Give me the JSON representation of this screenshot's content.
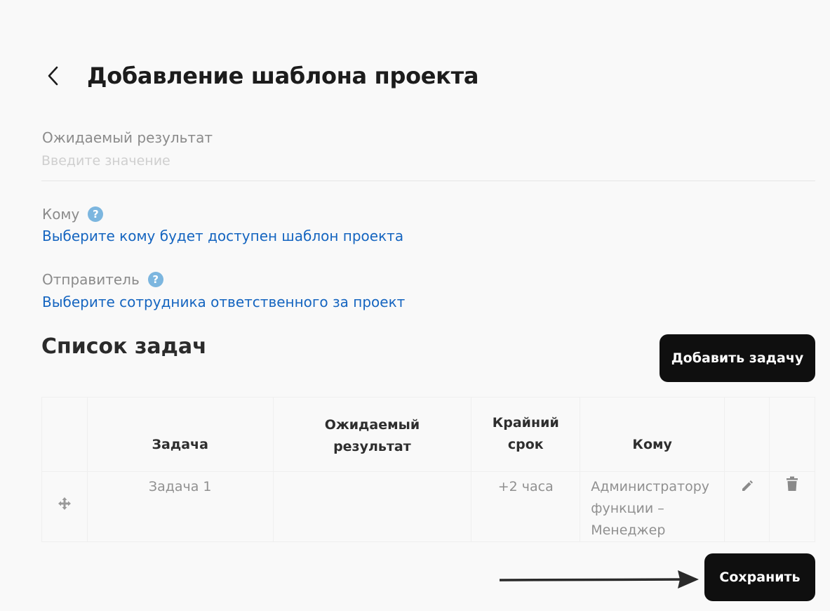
{
  "header": {
    "title": "Добавление шаблона проекта",
    "back_icon": "chevron-left-icon"
  },
  "fields": {
    "expected_result": {
      "label": "Ожидаемый результат",
      "placeholder": "Введите значение"
    },
    "recipient": {
      "label": "Кому",
      "help": "?",
      "link": "Выберите кому будет доступен шаблон проекта"
    },
    "sender": {
      "label": "Отправитель",
      "help": "?",
      "link": "Выберите сотрудника ответственного за проект"
    }
  },
  "tasks": {
    "title": "Список задач",
    "add_label": "Добавить задачу",
    "columns": {
      "task": "Задача",
      "result": "Ожидаемый результат",
      "deadline": "Крайний срок",
      "to": "Кому"
    },
    "rows": [
      {
        "task": "Задача 1",
        "result": "",
        "deadline": "+2 часа",
        "to": "Администратору функции – Менеджер"
      }
    ]
  },
  "footer": {
    "save_label": "Сохранить"
  },
  "colors": {
    "accent_link": "#1565c0",
    "button_bg": "#0f0f0f",
    "help_icon": "#7cb6df",
    "background": "#f9f9f9"
  }
}
